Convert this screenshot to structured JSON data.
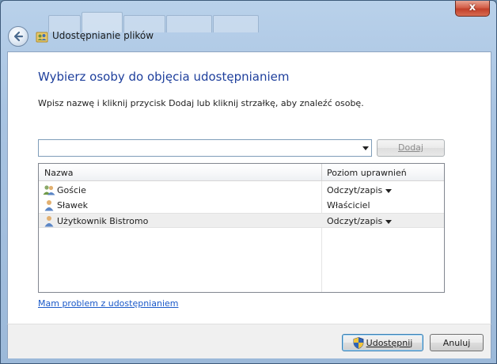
{
  "window": {
    "title": "Udostępnianie plików",
    "close_glyph": "x"
  },
  "content": {
    "heading": "Wybierz osoby do objęcia udostępnianiem",
    "instruction": "Wpisz nazwę i kliknij przycisk Dodaj lub kliknij strzałkę, aby znaleźć osobę.",
    "name_input": {
      "value": "",
      "placeholder": ""
    },
    "add_button": "Dodaj",
    "help_link": "Mam problem z udostępnianiem"
  },
  "list": {
    "columns": [
      "Nazwa",
      "Poziom uprawnień"
    ],
    "rows": [
      {
        "name": "Goście",
        "permission": "Odczyt/zapis",
        "icon": "group-users-icon",
        "has_dropdown": true,
        "selected": false
      },
      {
        "name": "Sławek",
        "permission": "Właściciel",
        "icon": "user-icon",
        "has_dropdown": false,
        "selected": false
      },
      {
        "name": "Użytkownik Bistromo",
        "permission": "Odczyt/zapis",
        "icon": "user-icon",
        "has_dropdown": true,
        "selected": true
      }
    ]
  },
  "footer": {
    "share_button": "Udostępnij",
    "cancel_button": "Anuluj"
  }
}
